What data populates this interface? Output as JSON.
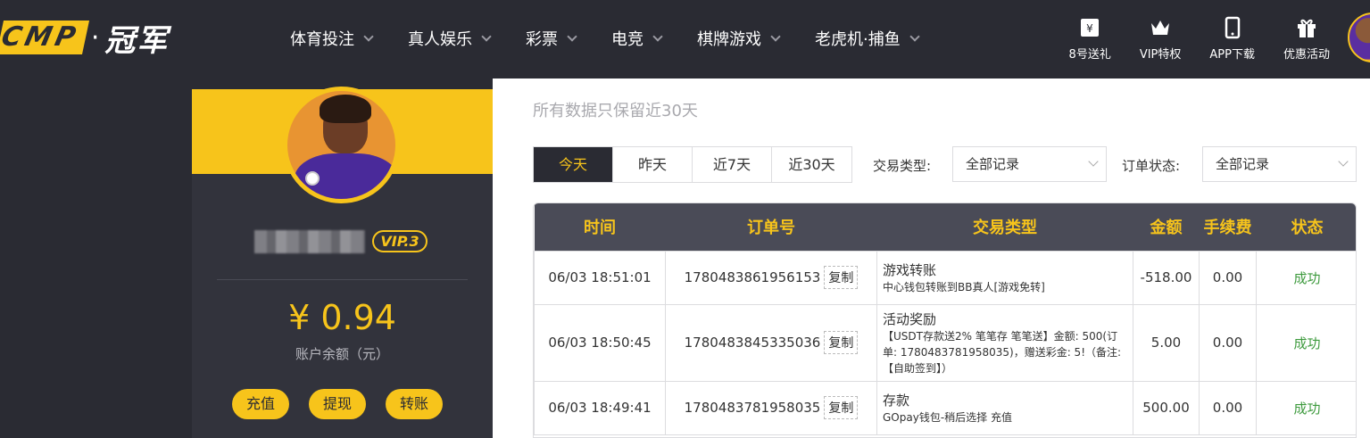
{
  "header": {
    "logo_letters": "CMP",
    "logo_dot": "·",
    "logo_cn": "冠军",
    "nav": [
      "体育投注",
      "真人娱乐",
      "彩票",
      "电竞",
      "棋牌游戏",
      "老虎机·捕鱼"
    ],
    "right_nav": [
      {
        "label": "8号送礼",
        "icon": "gift-8-icon"
      },
      {
        "label": "VIP特权",
        "icon": "crown-icon"
      },
      {
        "label": "APP下载",
        "icon": "phone-icon"
      },
      {
        "label": "优惠活动",
        "icon": "gift-box-icon"
      }
    ]
  },
  "sidebar": {
    "vip_label": "VIP.3",
    "balance": "¥ 0.94",
    "balance_label": "账户余额（元）",
    "actions": [
      "充值",
      "提现",
      "转账"
    ]
  },
  "main": {
    "notice": "所有数据只保留近30天",
    "date_tabs": [
      "今天",
      "昨天",
      "近7天",
      "近30天"
    ],
    "active_tab": "今天",
    "filters": {
      "type_label": "交易类型:",
      "type_value": "全部记录",
      "status_label": "订单状态:",
      "status_value": "全部记录"
    },
    "table": {
      "headers": [
        "时间",
        "订单号",
        "交易类型",
        "金额",
        "手续费",
        "状态"
      ],
      "copy_label": "复制",
      "rows": [
        {
          "time": "06/03 18:51:01",
          "order": "1780483861956153",
          "type": "游戏转账",
          "detail": "中心钱包转账到BB真人[游戏免转]",
          "amount": "-518.00",
          "fee": "0.00",
          "status": "成功"
        },
        {
          "time": "06/03 18:50:45",
          "order": "1780483845335036",
          "type": "活动奖励",
          "detail": "【USDT存款送2% 笔笔存 笔笔送】金额: 500(订单: 1780483781958035)，赠送彩金: 5!（备注: 【自助签到】）",
          "amount": "5.00",
          "fee": "0.00",
          "status": "成功"
        },
        {
          "time": "06/03 18:49:41",
          "order": "1780483781958035",
          "type": "存款",
          "detail": "GOpay钱包-稍后选择 充值",
          "amount": "500.00",
          "fee": "0.00",
          "status": "成功"
        }
      ]
    }
  },
  "colors": {
    "accent": "#f7c41b",
    "dark": "#2a2b33",
    "success": "#3d9a3d"
  }
}
